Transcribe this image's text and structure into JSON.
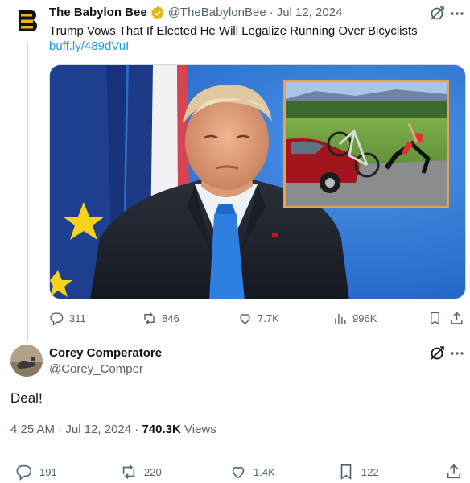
{
  "tweet": {
    "author_name": "The Babylon Bee",
    "author_handle": "@TheBabylonBee",
    "separator": "·",
    "date": "Jul 12, 2024",
    "text": "Trump Vows That If Elected He Will Legalize Running Over Bicyclists",
    "link": "buff.ly/489dVuI",
    "stats": {
      "replies": "311",
      "reposts": "846",
      "likes": "7.7K",
      "views": "996K"
    }
  },
  "reply": {
    "author_name": "Corey Comperatore",
    "author_handle": "@Corey_Comper",
    "text": "Deal!",
    "time": "4:25 AM",
    "separator": "·",
    "date": "Jul 12, 2024",
    "views_count": "740.3K",
    "views_label": "Views",
    "stats": {
      "replies": "191",
      "reposts": "220",
      "likes": "1.4K",
      "bookmarks": "122"
    }
  },
  "colors": {
    "text": "#0f1419",
    "muted": "#536471",
    "link": "#1d9bf0",
    "verified_gold": "#e2b719",
    "media_blue": "#2f74d6"
  },
  "icons": [
    "babylon-bee-logo",
    "verified-badge-icon",
    "grok-icon",
    "more-icon",
    "reply-icon",
    "repost-icon",
    "like-icon",
    "views-icon",
    "bookmark-icon",
    "share-icon"
  ]
}
